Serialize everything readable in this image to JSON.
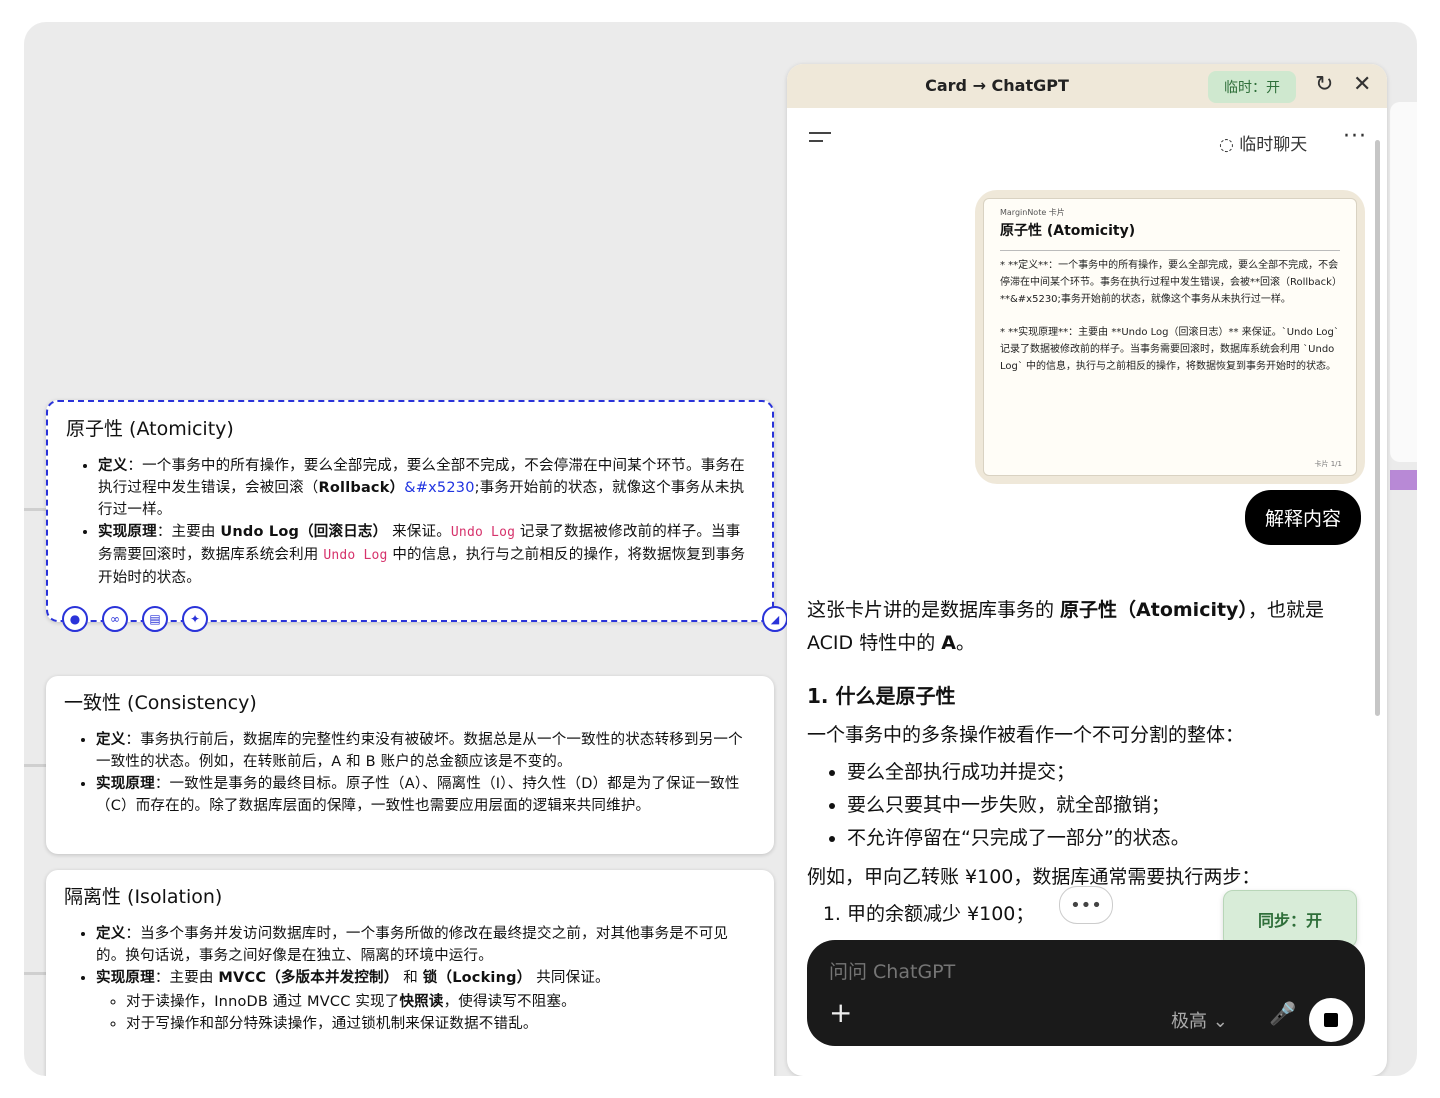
{
  "cards": [
    {
      "title": "原子性 (Atomicity)",
      "items": [
        {
          "label": "定义",
          "text": "：一个事务中的所有操作，要么全部完成，要么全部不完成，不会停滞在中间某个环节。事务在执行过程中发生错误，会被回滚（",
          "bold2": "Rollback）",
          "entity": "&#x5230",
          "text2": ";事务开始前的状态，就像这个事务从未执行过一样。"
        },
        {
          "label": "实现原理",
          "text": "：主要由 ",
          "bold2": "Undo Log（回滚日志）",
          "text2": " 来保证。",
          "code1": "Undo Log",
          "text3": " 记录了数据被修改前的样子。当事务需要回滚时，数据库系统会利用 ",
          "code2": "Undo Log",
          "text4": " 中的信息，执行与之前相反的操作，将数据恢复到事务开始时的状态。"
        }
      ]
    },
    {
      "title": "一致性 (Consistency)",
      "items": [
        {
          "label": "定义",
          "text": "：事务执行前后，数据库的完整性约束没有被破坏。数据总是从一个一致性的状态转移到另一个一致性的状态。例如，在转账前后，A 和 B 账户的总金额应该是不变的。"
        },
        {
          "label": "实现原理",
          "text": "：一致性是事务的最终目标。原子性（A）、隔离性（I）、持久性（D）都是为了保证一致性（C）而存在的。除了数据库层面的保障，一致性也需要应用层面的逻辑来共同维护。"
        }
      ]
    },
    {
      "title": "隔离性 (Isolation)",
      "items": [
        {
          "label": "定义",
          "text": "：当多个事务并发访问数据库时，一个事务所做的修改在最终提交之前，对其他事务是不可见的。换句话说，事务之间好像是在独立、隔离的环境中运行。"
        },
        {
          "label": "实现原理",
          "text": "：主要由 ",
          "bold2": "MVCC（多版本并发控制）",
          "text2": " 和 ",
          "bold3": "锁（Locking）",
          "text3": " 共同保证。"
        }
      ],
      "subitems": [
        {
          "text": "对于读操作，InnoDB 通过 MVCC 实现了",
          "bold": "快照读",
          "text2": "，使得读写不阻塞。"
        },
        {
          "text": "对于写操作和部分特殊读操作，通过锁机制来保证数据不错乱。"
        }
      ]
    }
  ],
  "panel": {
    "title": "Card → ChatGPT",
    "temp_badge": "临时：开",
    "temp_chat": "临时聊天",
    "note": {
      "app": "MarginNote 卡片",
      "title": "原子性 (Atomicity)",
      "p1": "* **定义**：一个事务中的所有操作，要么全部完成，要么全部不完成，不会停滞在中间某个环节。事务在执行过程中发生错误，会被**回滚（Rollback）**&#x5230;事务开始前的状态，就像这个事务从未执行过一样。",
      "p2": "* **实现原理**：主要由 **Undo Log（回滚日志）** 来保证。`Undo Log` 记录了数据被修改前的样子。当事务需要回滚时，数据库系统会利用 `Undo Log` 中的信息，执行与之前相反的操作，将数据恢复到事务开始时的状态。",
      "footer": "卡片 1/1"
    },
    "explain_button": "解释内容",
    "answer": {
      "intro_a": "这张卡片讲的是数据库事务的 ",
      "intro_b": "原子性（Atomicity）",
      "intro_c": "，也就是 ACID 特性中的 ",
      "intro_d": "A",
      "intro_e": "。",
      "heading": "1. 什么是原子性",
      "p2": "一个事务中的多条操作被看作一个不可分割的整体：",
      "bullets": [
        "要么全部执行成功并提交；",
        "要么只要其中一步失败，就全部撤销；",
        "不允许停留在“只完成了一部分”的状态。"
      ],
      "p3": "例如，甲向乙转账 ¥100，数据库通常需要执行两步：",
      "steps": [
        "甲的余额减少 ¥100；"
      ]
    },
    "sync_badge": "同步：开",
    "composer": {
      "placeholder": "问问 ChatGPT",
      "model": "极高"
    }
  }
}
